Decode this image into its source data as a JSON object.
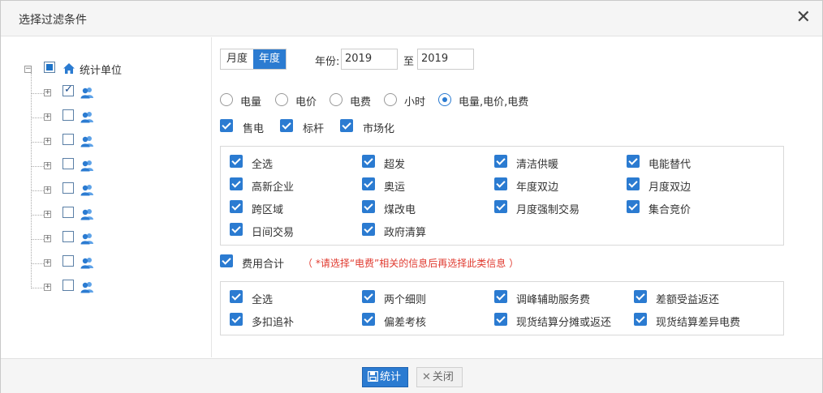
{
  "dialog": {
    "title": "选择过滤条件",
    "close_glyph": "✕"
  },
  "tree": {
    "root_label": "统计单位",
    "children": [
      {
        "checked": true
      },
      {
        "checked": false
      },
      {
        "checked": false
      },
      {
        "checked": false
      },
      {
        "checked": false
      },
      {
        "checked": false
      },
      {
        "checked": false
      },
      {
        "checked": false
      },
      {
        "checked": false
      }
    ]
  },
  "period": {
    "tabs": [
      "月度",
      "年度"
    ],
    "active_tab": "年度",
    "year_label": "年份:",
    "year_from": "2019",
    "to_label": "至",
    "year_to": "2019"
  },
  "metrics": {
    "options": [
      "电量",
      "电价",
      "电费",
      "小时",
      "电量,电价,电费"
    ],
    "selected": "电量,电价,电费"
  },
  "categories": {
    "items": [
      "售电",
      "标杆",
      "市场化"
    ],
    "checked": [
      true,
      true,
      true
    ]
  },
  "market_types": {
    "items": [
      "全选",
      "超发",
      "清洁供暖",
      "电能替代",
      "高新企业",
      "奥运",
      "年度双边",
      "月度双边",
      "跨区域",
      "煤改电",
      "月度强制交易",
      "集合竞价",
      "日间交易",
      "政府清算"
    ]
  },
  "fee_total": {
    "label": "费用合计",
    "note": "（ *请选择“电费”相关的信息后再选择此类信息 ）",
    "items": [
      "全选",
      "两个细则",
      "调峰辅助服务费",
      "差额受益返还",
      "多扣追补",
      "偏差考核",
      "现货结算分摊或返还",
      "现货结算差异电费"
    ]
  },
  "footer": {
    "stat_label": "统计",
    "close_label": "关闭"
  },
  "colors": {
    "accent": "#2b7bd1",
    "warning": "#e03a2f"
  }
}
